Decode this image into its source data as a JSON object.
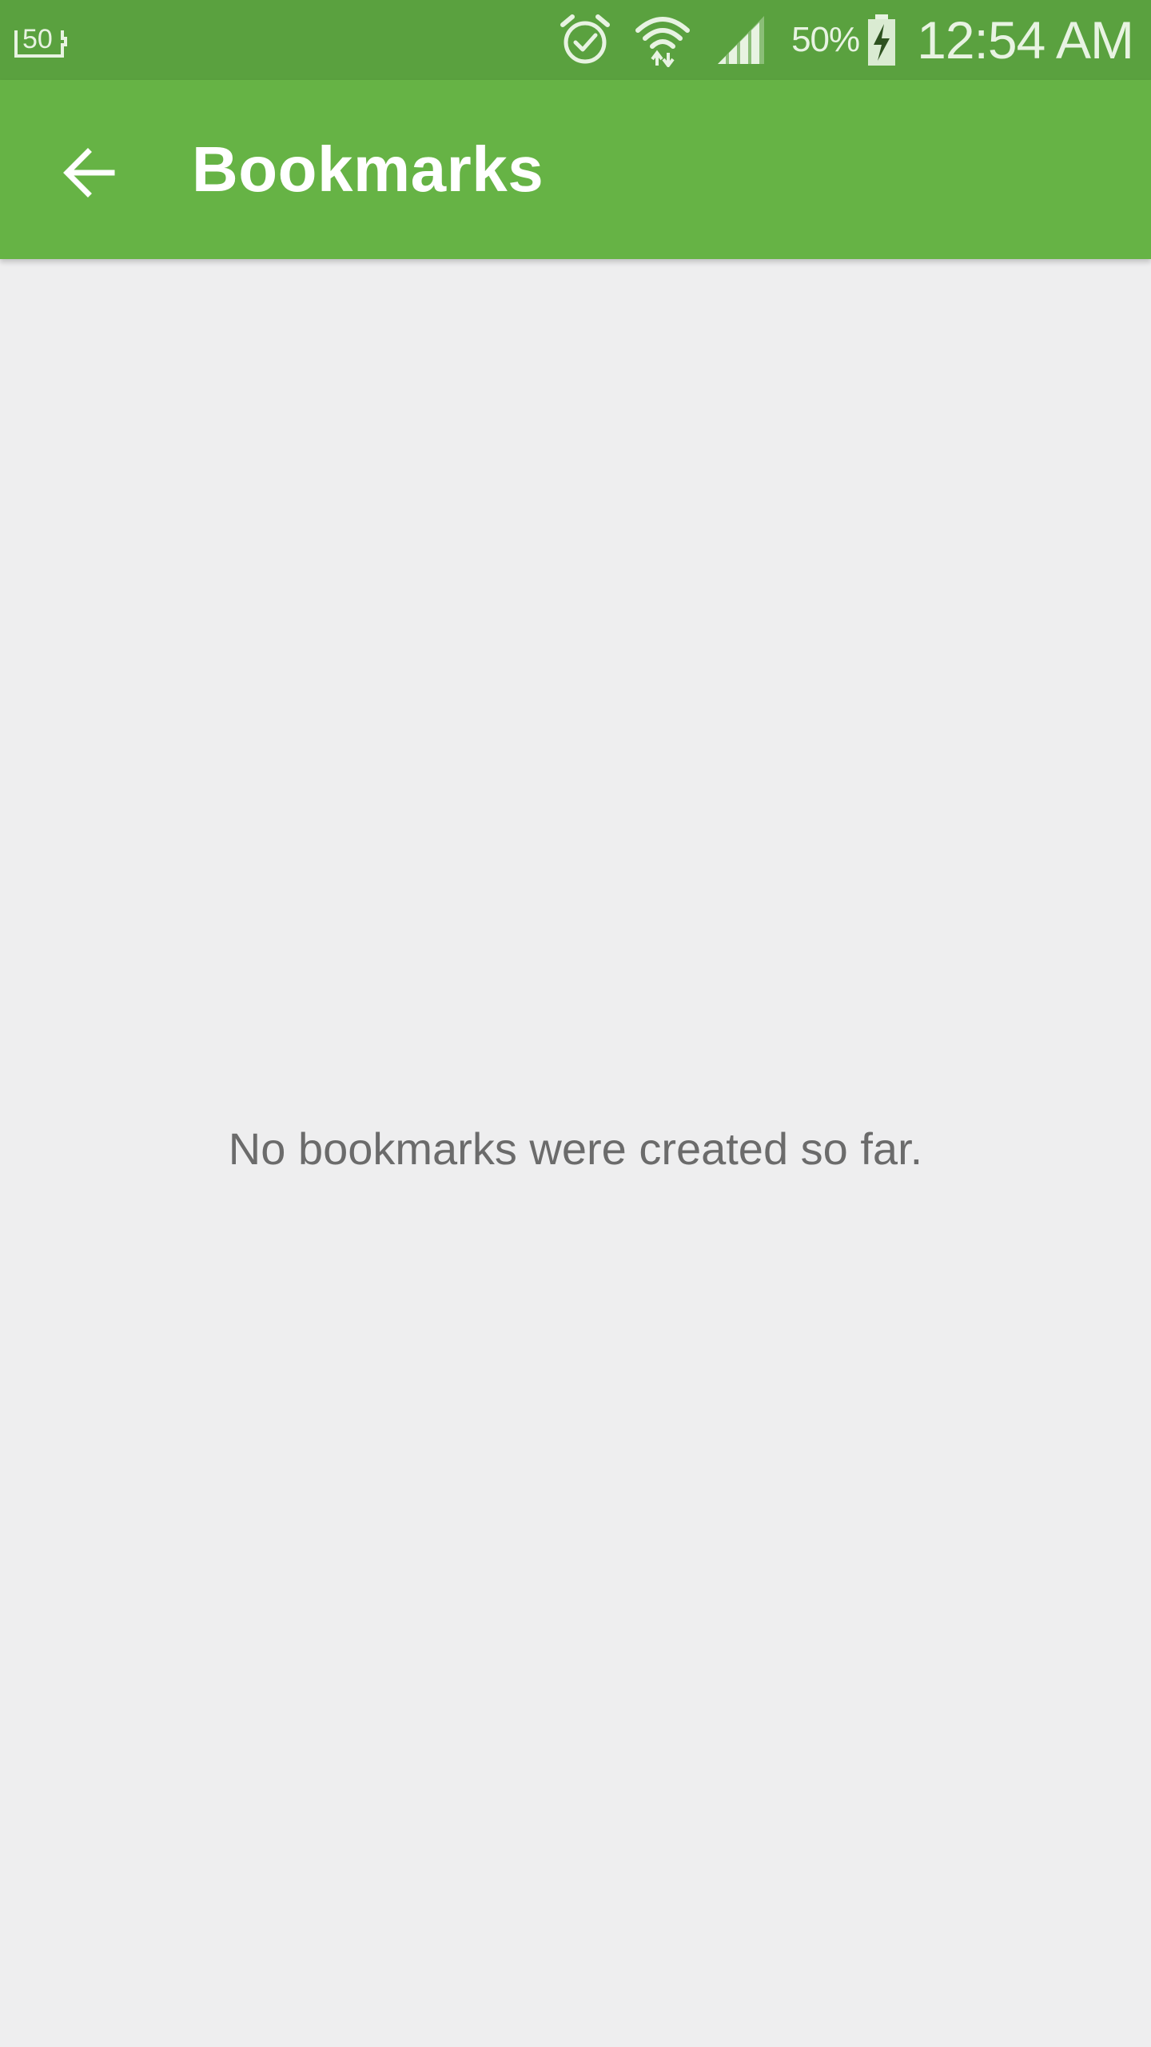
{
  "status_bar": {
    "left_icon": "storage-50-icon",
    "left_icon_text": "50",
    "icons": [
      "alarm-icon",
      "wifi-icon",
      "signal-icon"
    ],
    "battery_percent": "50%",
    "battery_icon": "battery-charging-icon",
    "time": "12:54 AM"
  },
  "app_bar": {
    "back_icon": "arrow-back-icon",
    "title": "Bookmarks"
  },
  "main": {
    "empty_message": "No bookmarks were created so far."
  },
  "colors": {
    "status_bar": "#5aa13f",
    "app_bar": "#66b345",
    "background": "#eeeeef",
    "message_text": "#6b6b6b"
  }
}
